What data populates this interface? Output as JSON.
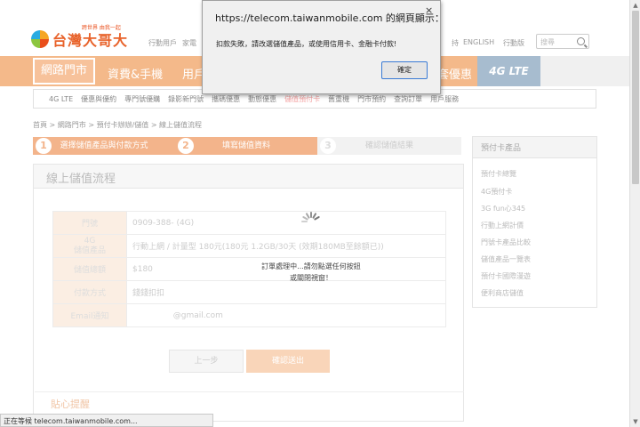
{
  "header": {
    "slogan": "跨世界 由我一起",
    "logo_text": "台灣大哥大",
    "links": [
      "行動用戶",
      "家電",
      "持",
      "ENGLISH",
      "行動版"
    ],
    "search_placeholder": "搜尋"
  },
  "nav": {
    "items": [
      "網路門市",
      "資費&手機",
      "用戶",
      "套優惠",
      "4G LTE"
    ],
    "active_index": 0
  },
  "subnav": {
    "items": [
      "4G LTE",
      "優惠與優約",
      "專門號優購",
      "錄影新門號",
      "攜碼優惠",
      "動態優惠",
      "儲值預付卡",
      "舊重機",
      "門市預約",
      "查詢訂單",
      "用戶服務"
    ],
    "highlight_index": 6
  },
  "breadcrumb": "首頁 > 網路門市 > 預付卡辦辦/儲值 > 線上儲值流程",
  "steps": [
    {
      "num": "1",
      "label": "選擇儲值產品與付款方式"
    },
    {
      "num": "2",
      "label": "填寫儲值資料"
    },
    {
      "num": "3",
      "label": "確認儲值結果"
    }
  ],
  "panel": {
    "title": "線上儲值流程",
    "rows": [
      {
        "key": "門號",
        "value": "0909-388-       (4G)"
      },
      {
        "key": "4G\n儲值產品",
        "value": "行動上網 / 計量型 180元(180元 1.2GB/30天 (效期180MB至餘額已))"
      },
      {
        "key": "儲值總額",
        "value": "$180"
      },
      {
        "key": "付款方式",
        "value": "錢錢扣扣"
      },
      {
        "key": "Email通知",
        "value": "                @gmail.com"
      }
    ],
    "prev_button": "上一步",
    "next_button": "確認送出",
    "tips_title": "貼心提醒"
  },
  "sidebar": {
    "title": "預付卡產品",
    "items": [
      "預付卡總覽",
      "4G預付卡",
      "3G fun心345",
      "行動上網計價",
      "門號卡產品比較",
      "儲值產品一覽表",
      "預付卡國際漫遊",
      "便利商店儲值"
    ]
  },
  "processing": {
    "line1": "訂單處理中...請勿點選任何按鈕",
    "line2": "或關閉視窗！"
  },
  "status_bar": "正在等候 telecom.taiwanmobile.com...",
  "dialog": {
    "title": "https://telecom.taiwanmobile.com 的網頁顯示：",
    "message": "扣款失敗，請改選儲值產品，或使用信用卡、金融卡付款!",
    "ok_label": "確定",
    "close_glyph": "×"
  },
  "colors": {
    "brand_orange": "#f4b98a",
    "accent": "#e8622a",
    "lte_blue": "#a7bccf"
  }
}
